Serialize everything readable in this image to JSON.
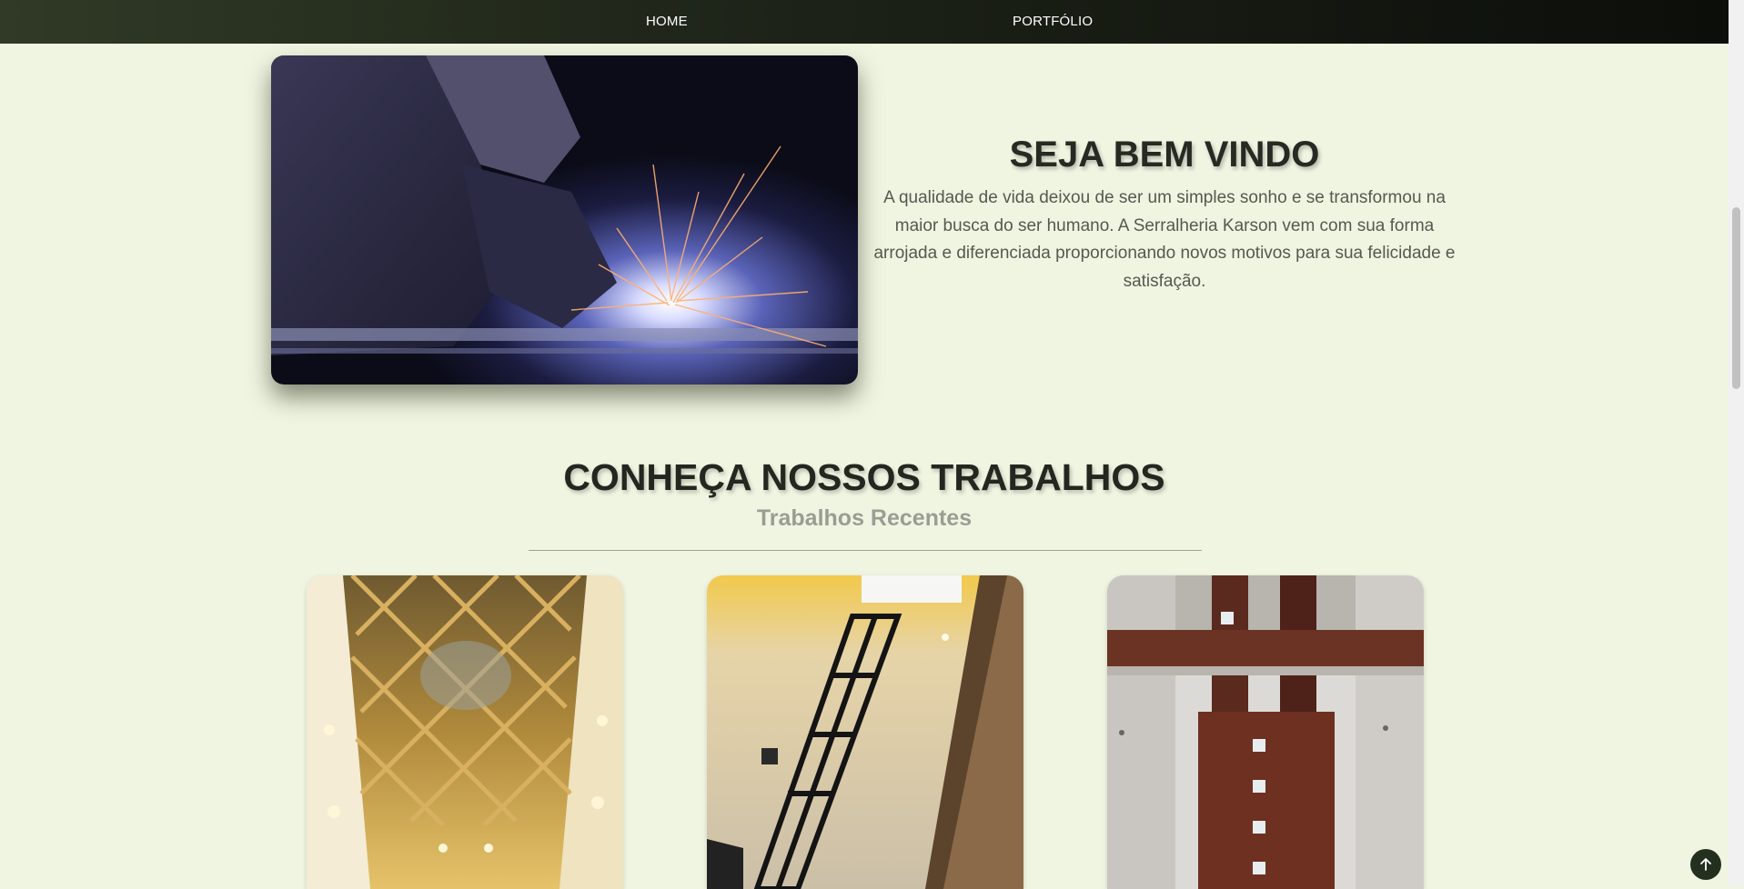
{
  "nav": {
    "items": [
      {
        "label": "HOME"
      },
      {
        "label": "PORTFÓLIO"
      }
    ]
  },
  "hero": {
    "image_icon": "welding-photo",
    "title": "SEJA BEM VINDO",
    "text": "A qualidade de vida deixou de ser um simples sonho e se transformou na maior busca do ser humano. A Serralheria Karson vem com sua forma arrojada e diferenciada proporcionando novos motivos para sua felicidade e satisfação."
  },
  "works": {
    "title": "CONHEÇA NOSSOS TRABALHOS",
    "subtitle": "Trabalhos Recentes",
    "cards": [
      {
        "icon": "mirror-ceiling-photo"
      },
      {
        "icon": "glass-shower-door-photo"
      },
      {
        "icon": "corten-steel-door-photo"
      }
    ]
  },
  "back_to_top": {
    "icon": "arrow-up-icon"
  },
  "colors": {
    "page_background": "#f0f5e2",
    "nav_dark": "#0c0e0a",
    "nav_green": "#303a26",
    "heading": "#262a22",
    "subtitle": "#9a9d93",
    "body_text": "#55594f"
  }
}
